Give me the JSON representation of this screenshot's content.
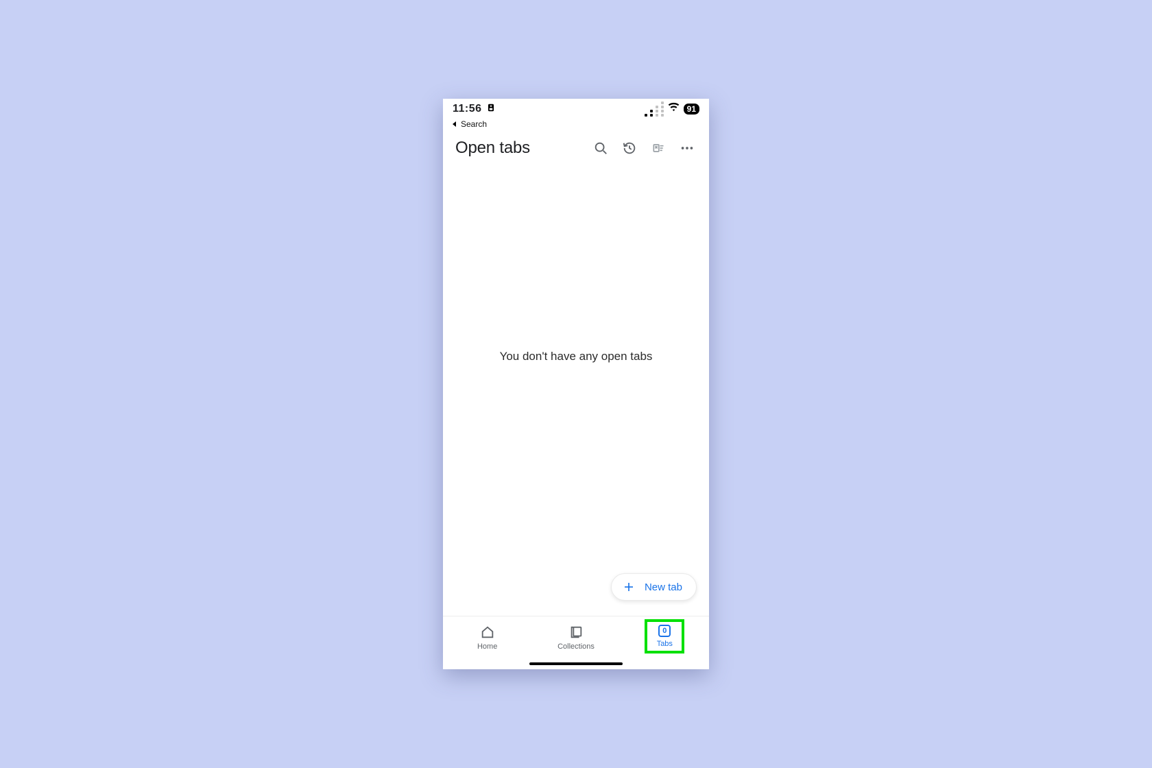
{
  "statusbar": {
    "time": "11:56",
    "battery": "91"
  },
  "backline": {
    "label": "Search"
  },
  "header": {
    "title": "Open tabs"
  },
  "main": {
    "empty_message": "You don't have any open tabs"
  },
  "newtab": {
    "label": "New tab"
  },
  "bottomnav": {
    "items": [
      {
        "label": "Home"
      },
      {
        "label": "Collections"
      },
      {
        "label": "Tabs",
        "count": "0"
      }
    ]
  }
}
